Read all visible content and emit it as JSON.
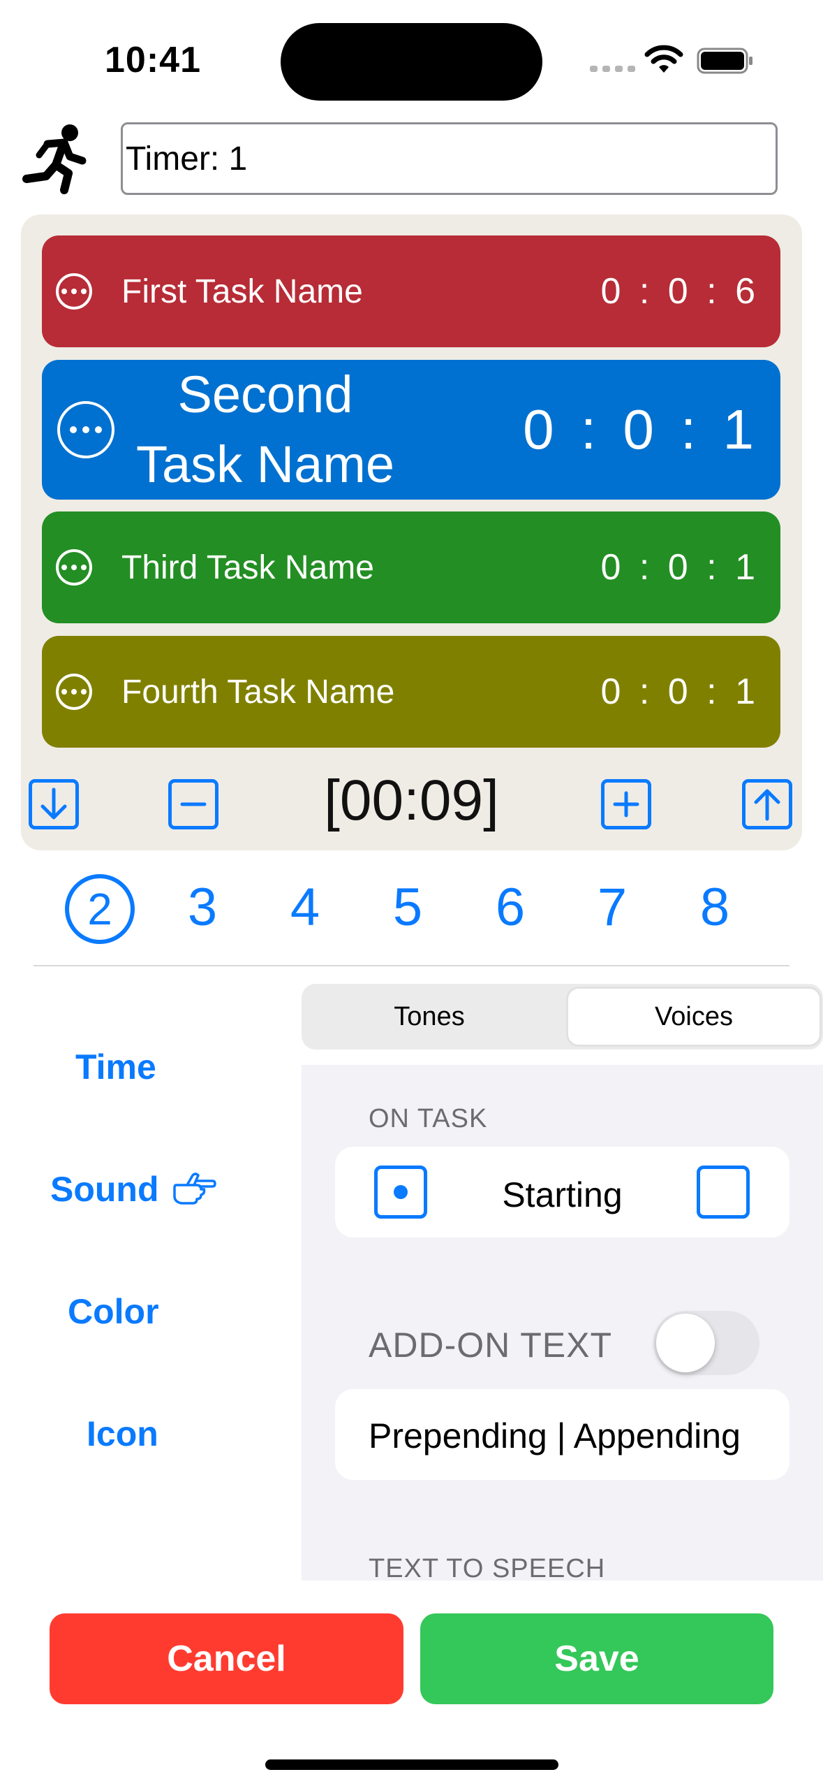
{
  "status": {
    "time": "10:41"
  },
  "header": {
    "timer_name_value": "Timer: 1"
  },
  "tasks": [
    {
      "name": "First Task Name",
      "time": "0 : 0 : 6",
      "color": "#b72c36"
    },
    {
      "name_line1": "Second",
      "name_line2": "Task Name",
      "time": "0 : 0 : 1",
      "color": "#0071d0"
    },
    {
      "name": "Third Task Name",
      "time": "0 : 0 : 1",
      "color": "#238e23"
    },
    {
      "name": "Fourth Task Name",
      "time": "0 : 0 : 1",
      "color": "#808000"
    }
  ],
  "total_time": "[00:09]",
  "numbers": {
    "selected": "2",
    "others": [
      "3",
      "4",
      "5",
      "6",
      "7",
      "8"
    ]
  },
  "side_menu": {
    "time": "Time",
    "sound": "Sound",
    "color": "Color",
    "icon": "Icon"
  },
  "segmented": {
    "tones": "Tones",
    "voices": "Voices",
    "selected": "Voices"
  },
  "settings": {
    "on_task_header": "ON TASK",
    "starting_label": "Starting",
    "addon_header": "ADD-ON TEXT",
    "addon_toggle_on": false,
    "addon_value": "Prepending | Appending",
    "tts_header": "TEXT TO SPEECH"
  },
  "buttons": {
    "cancel": "Cancel",
    "save": "Save"
  },
  "colors": {
    "accent": "#0a7aff",
    "cancel": "#ff3b30",
    "save": "#34c759",
    "panel": "#efece5"
  }
}
